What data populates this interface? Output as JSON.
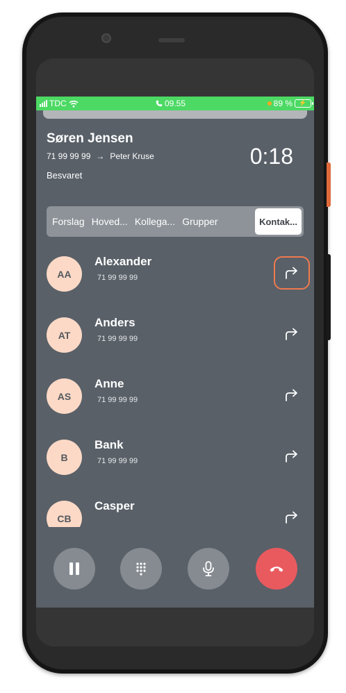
{
  "status_bar": {
    "carrier": "TDC",
    "time": "09.55",
    "battery": "89 %"
  },
  "call": {
    "caller_name": "Søren Jensen",
    "number": "71 99 99 99",
    "arrow": "→",
    "transfer_to": "Peter Kruse",
    "status": "Besvaret",
    "timer": "0:18"
  },
  "tabs": [
    {
      "label": "Forslag",
      "active": false
    },
    {
      "label": "Hoved...",
      "active": false
    },
    {
      "label": "Kollega...",
      "active": false
    },
    {
      "label": "Grupper",
      "active": false
    },
    {
      "label": "Kontak...",
      "active": true
    }
  ],
  "contacts": [
    {
      "initials": "AA",
      "name": "Alexander",
      "phone": "71 99 99 99",
      "highlighted": true
    },
    {
      "initials": "AT",
      "name": "Anders",
      "phone": "71 99 99 99",
      "highlighted": false
    },
    {
      "initials": "AS",
      "name": "Anne",
      "phone": "71 99 99 99",
      "highlighted": false
    },
    {
      "initials": "B",
      "name": "Bank",
      "phone": "71 99 99 99",
      "highlighted": false
    },
    {
      "initials": "CB",
      "name": "Casper",
      "phone": "",
      "highlighted": false
    }
  ],
  "controls": [
    {
      "name": "pause",
      "icon": "pause-icon"
    },
    {
      "name": "keypad",
      "icon": "keypad-icon"
    },
    {
      "name": "microphone",
      "icon": "microphone-icon"
    },
    {
      "name": "end-call",
      "icon": "hang-up-icon"
    }
  ],
  "colors": {
    "status_green": "#4cd964",
    "screen_bg": "#596068",
    "avatar_bg": "#fcd9c6",
    "highlight": "#f07a4e",
    "end_call": "#e95a5f"
  }
}
